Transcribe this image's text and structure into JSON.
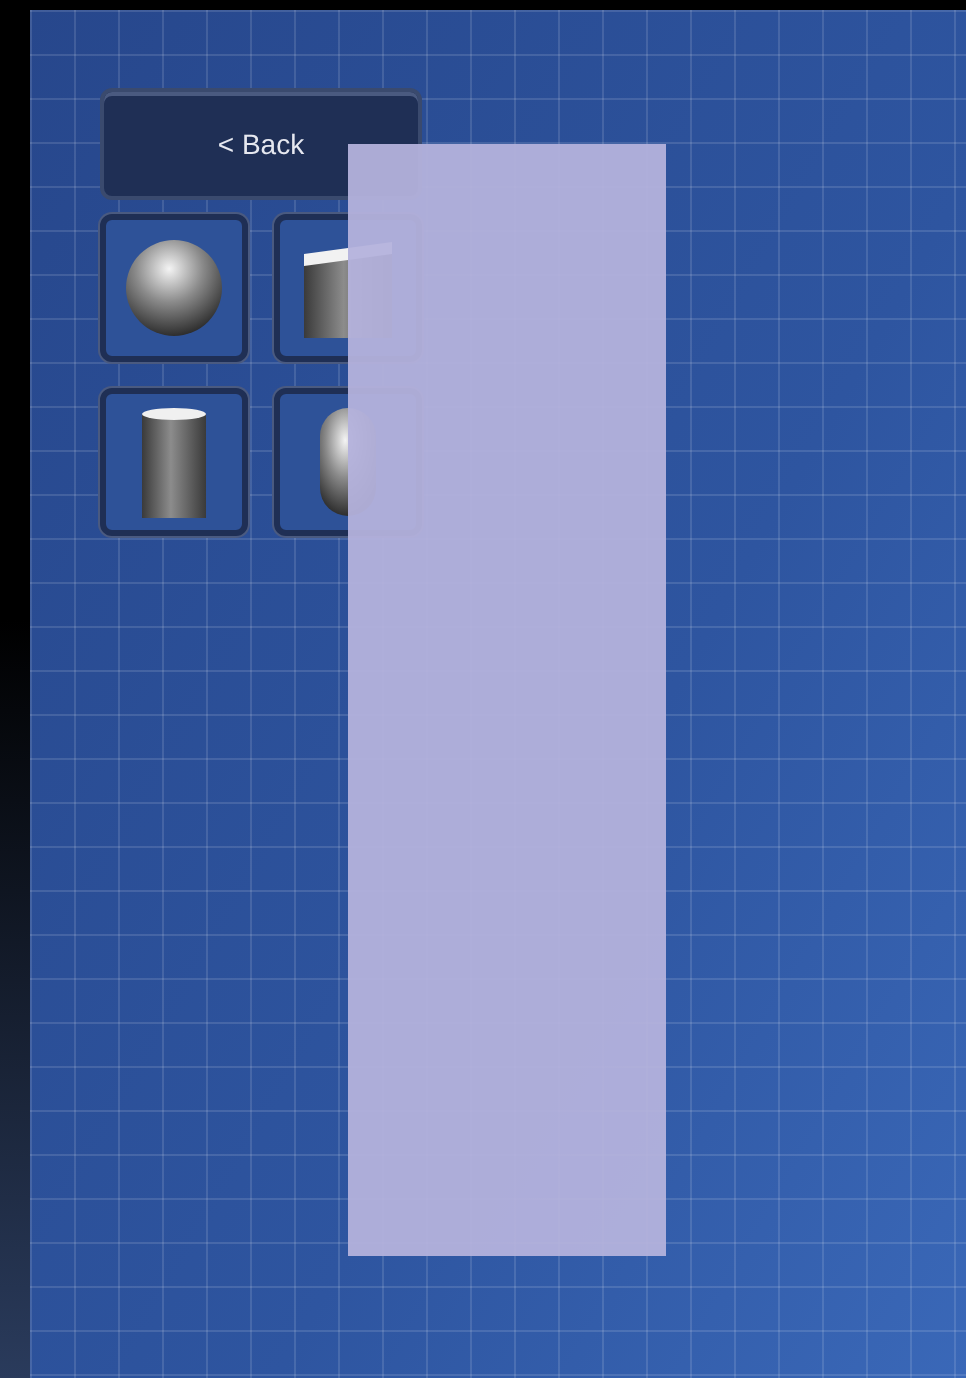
{
  "back_button": {
    "label": "< Back"
  },
  "shape_buttons": [
    {
      "kind": "sphere"
    },
    {
      "kind": "cube"
    },
    {
      "kind": "cylinder"
    },
    {
      "kind": "capsule"
    }
  ]
}
